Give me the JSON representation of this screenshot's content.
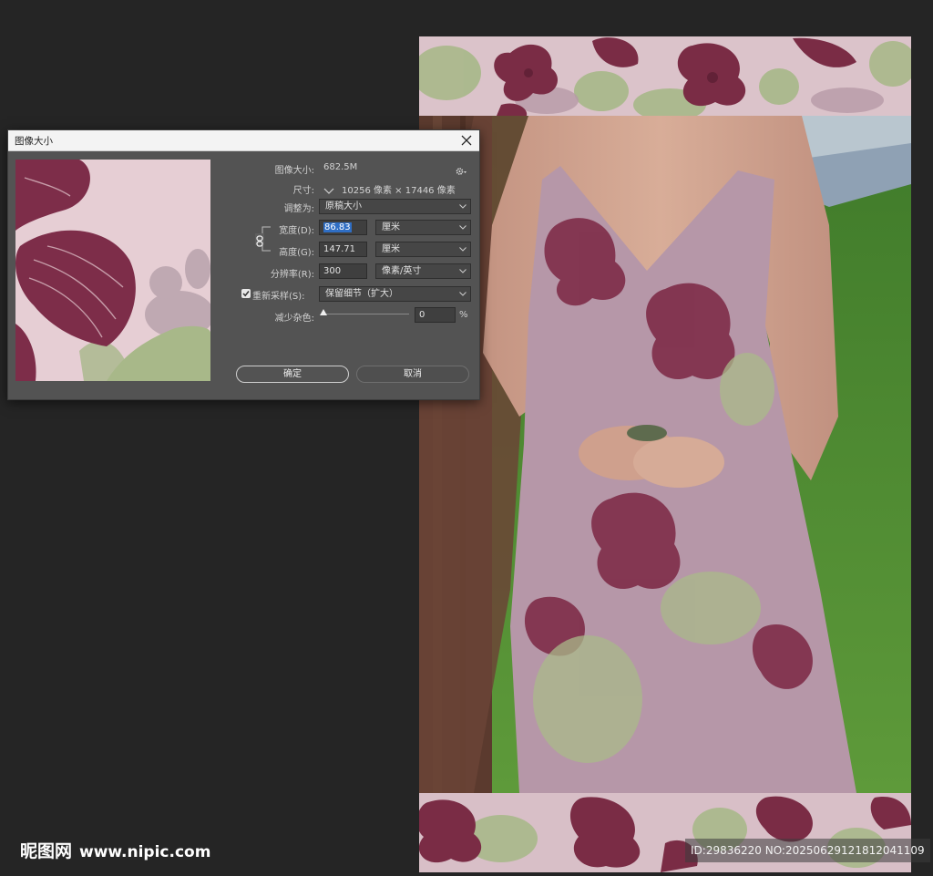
{
  "dialog": {
    "title": "图像大小",
    "image_size_label": "图像大小:",
    "image_size_value": "682.5M",
    "dimensions_label": "尺寸:",
    "dimensions_value": "10256 像素 × 17446 像素",
    "fit_to_label": "调整为:",
    "fit_to_value": "原稿大小",
    "width_label": "宽度(D):",
    "width_value": "86.83",
    "width_unit": "厘米",
    "height_label": "高度(G):",
    "height_value": "147.71",
    "height_unit": "厘米",
    "resolution_label": "分辨率(R):",
    "resolution_value": "300",
    "resolution_unit": "像素/英寸",
    "resample_label": "重新采样(S):",
    "resample_checked": true,
    "resample_value": "保留细节（扩大）",
    "noise_label": "减少杂色:",
    "noise_value": "0",
    "noise_unit": "%",
    "ok_label": "确定",
    "cancel_label": "取消"
  },
  "watermark": {
    "site_name": "昵图网",
    "url": "www.nipic.com",
    "id_text": "ID:29836220 NO:20250629121812041109"
  },
  "colors": {
    "workspace_bg": "#252525",
    "dialog_bg": "#535353",
    "selection_blue": "#2f6ec4",
    "floral_pink": "#d9bec6",
    "floral_burgundy": "#7a2c45",
    "floral_green": "#a9b98a"
  },
  "icons": {
    "close": "close-icon",
    "settings": "gear-icon",
    "link": "chain-link-icon",
    "dropdown": "chevron-down-icon",
    "checkbox": "checkmark-icon"
  }
}
